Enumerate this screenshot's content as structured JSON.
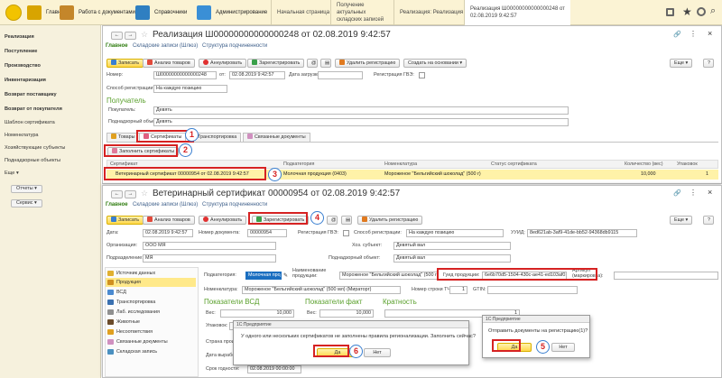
{
  "topbar": {
    "sections": [
      {
        "label": "Главное",
        "icon": "home-icon",
        "color": "#d8a400"
      },
      {
        "label": "Работа с документами",
        "icon": "folder-icon",
        "color": "#c4862a"
      },
      {
        "label": "Справочники",
        "icon": "book-icon",
        "color": "#2f7fc1"
      },
      {
        "label": "Администрирование",
        "icon": "tools-icon",
        "color": "#3a8fd6"
      }
    ],
    "tabs": [
      "Начальная страница",
      "Получение актуальных складских записей",
      "Реализация: Реализация",
      "Реализация Ш00000000000000248 от 02.08.2019 9:42:57"
    ]
  },
  "sidebar": {
    "items": [
      {
        "label": "Реализация",
        "bold": true
      },
      {
        "label": "Поступление",
        "bold": true
      },
      {
        "label": "Производство",
        "bold": true
      },
      {
        "label": "Инвентаризация",
        "bold": true
      },
      {
        "label": "Возврат поставщику",
        "bold": true
      },
      {
        "label": "Возврат от покупателя",
        "bold": true
      },
      {
        "label": "Шаблон сертификата",
        "bold": false
      },
      {
        "label": "Номенклатура",
        "bold": false
      },
      {
        "label": "Хозяйствующие субъекты",
        "bold": false
      },
      {
        "label": "Поднадзорные объекты",
        "bold": false
      },
      {
        "label": "Еще",
        "bold": false
      }
    ],
    "buttons": [
      "Отчеты",
      "Сервис"
    ]
  },
  "doc1": {
    "title": "Реализация Ш00000000000000248 от 02.08.2019 9:42:57",
    "nav": [
      "Главное",
      "Складские записи (Шлюз)",
      "Структура подчиненности"
    ],
    "toolbar": [
      "Записать",
      "Анализ товаров",
      "Аннулировать",
      "Зарегистрировать",
      "Удалить регистрацию",
      "Создать на основании",
      "Еще"
    ],
    "labels": {
      "number": "Номер:",
      "from": "от:",
      "load_date": "Дата загрузки",
      "reg_gve": "Регистрация ГВЭ:",
      "reg_method": "Способ регистрации:",
      "buyer": "Покупатель:",
      "supervised": "Поднадзорный объект:",
      "recipient": "Получатель"
    },
    "values": {
      "number": "Ш00000000000000248",
      "date": "02.08.2019  9:42:57",
      "reg_method": "На каждую позицию",
      "buyer": "Девять",
      "supervised": "Девять"
    },
    "tabs": [
      "Товары",
      "Сертификаты",
      "Транспортировка",
      "Связанные документы"
    ],
    "fill_button": "Заполнить сертификаты",
    "table": {
      "headers": [
        "Сертификат",
        "Подкатегория",
        "Номенклатура",
        "Статус сертификата",
        "Количество (вес)",
        "Упаковок"
      ],
      "row": {
        "certificate": "Ветеринарный сертификат 00000954 от 02.08.2019 9:42:57",
        "subcategory": "Молочная продукция (0403)",
        "nomenclature": "Мороженое \"Бельгийский шоколад\" (500 г)",
        "status": "",
        "qty": "10,000",
        "packs": "1"
      }
    }
  },
  "doc2": {
    "title": "Ветеринарный сертификат 00000954 от 02.08.2019 9:42:57",
    "nav": [
      "Главное",
      "Складские записи (Шлюз)",
      "Структура подчиненности"
    ],
    "toolbar": [
      "Записать",
      "Анализ товаров",
      "Аннулировать",
      "Зарегистрировать",
      "Удалить регистрацию",
      "Еще"
    ],
    "labels": {
      "date": "Дата:",
      "doc_number": "Номер документа:",
      "reg_gve": "Регистрация ГВЭ:",
      "reg_method": "Способ регистрации:",
      "uuid": "УУИД:",
      "organization": "Организация:",
      "subject": "Хоз. субъект:",
      "division": "Подразделение:",
      "supervised": "Поднадзорный объект:",
      "subcategory": "Подкатегория:",
      "name": "Наименование продукции:",
      "guid": "Гуид продукции:",
      "article": "Артикул (маркировка):",
      "nomenclature": "Номенклатура:",
      "line_no": "Номер строки ТЧ:",
      "gtin": "GTIN:",
      "vsd_indicators": "Показатели ВСД",
      "fact_indicators": "Показатели факт",
      "multiplicity": "Кратность",
      "weight": "Вес:",
      "packing": "Упаковок:",
      "origin": "Страна производства:",
      "prod_date": "Дата выработки:",
      "expiry": "Срок годности:"
    },
    "values": {
      "date": "02.08.2019  9:42:57",
      "doc_number": "00000954",
      "reg_method": "На каждую позицию",
      "uuid": "8ed621ab-3af9-41de-bb52-94368db9115",
      "organization": "ООО  МЯ",
      "subject": "Девятый вал",
      "division": "МЯ",
      "supervised": "Девятый вал",
      "subcategory": "Молочная продукция",
      "name": "Мороженое \"Бельгийский шоколад\" (500 г)",
      "guid": "6e6b70d5-1504-430c-ae41-ed103af0172",
      "nomenclature": "Мороженое \"Бельгийский шоколад\" (500 мл) (Мираторг)",
      "line_no": "1",
      "weight": "10,000",
      "weight2": "10,000",
      "multiplicity": "1",
      "expiry": "02.08.2019 00:00:00"
    },
    "left_nav": [
      "Источник данных",
      "Продукция",
      "ВСД",
      "Транспортировка",
      "Лаб. исследования",
      "Животные",
      "Несоответствия",
      "Связанные документы",
      "Складская запись"
    ]
  },
  "dialog1": {
    "header": "1С:Предприятие",
    "message": "У одного или нескольких сертификатов не заполнены правила регионализации. Заполнить сейчас?",
    "yes": "Да",
    "no": "Нет"
  },
  "dialog2": {
    "header": "1С:Предприятие",
    "message": "Отправить документы на регистрацию(1)?",
    "yes": "Да",
    "no": "Нет"
  },
  "markers": [
    "1",
    "2",
    "3",
    "4",
    "5",
    "6"
  ]
}
